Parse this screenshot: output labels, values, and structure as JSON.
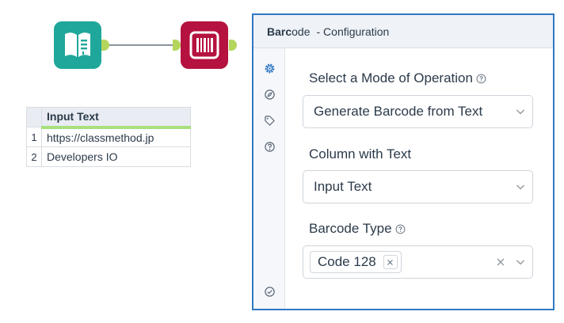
{
  "workflow": {
    "tools": [
      {
        "name": "Text Input",
        "icon": "book-icon",
        "color": "#1ea79a"
      },
      {
        "name": "Barcode",
        "icon": "barcode-icon",
        "color": "#b5123f"
      }
    ],
    "connection_color": "#8a949c",
    "anchor_color": "#b4d55c"
  },
  "grid": {
    "column_header": "Input Text",
    "rows": [
      {
        "num": "1",
        "value": "https://classmethod.jp"
      },
      {
        "num": "2",
        "value": "Developers IO"
      }
    ]
  },
  "panel": {
    "title_bold": "Barc",
    "title_rest": "ode",
    "subtitle": "- Configuration",
    "accent_color": "#2f78c4",
    "rail_icons": [
      "gear-icon",
      "compass-icon",
      "tag-icon",
      "help-icon",
      "check-circle-icon"
    ],
    "mode": {
      "label": "Select a Mode of Operation",
      "value": "Generate Barcode from Text"
    },
    "column": {
      "label": "Column with Text",
      "value": "Input Text"
    },
    "barcode_type": {
      "label": "Barcode Type",
      "tag": "Code 128"
    }
  }
}
